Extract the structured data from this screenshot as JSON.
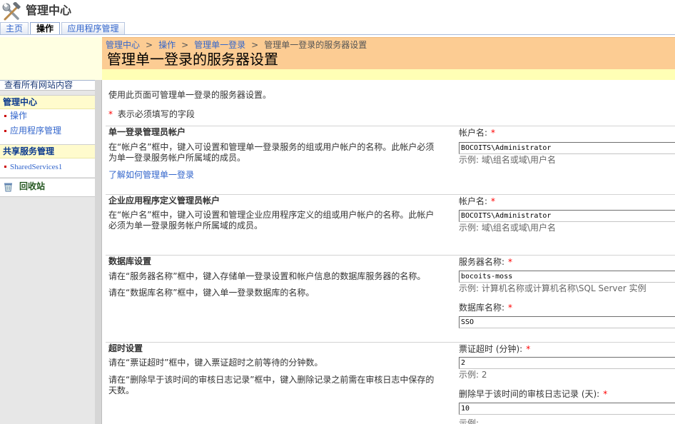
{
  "theme": {
    "link": "#3366cc",
    "title_band": "#fccc93",
    "required": "#ff0000"
  },
  "header": {
    "title": "管理中心",
    "icon": "tools-icon"
  },
  "tabs": [
    {
      "label": "主页",
      "selected": false
    },
    {
      "label": "操作",
      "selected": true
    },
    {
      "label": "应用程序管理",
      "selected": false
    }
  ],
  "breadcrumb": {
    "items": [
      "管理中心",
      "操作",
      "管理单一登录",
      "管理单一登录的服务器设置"
    ],
    "separator": ">"
  },
  "page_title": "管理单一登录的服务器设置",
  "leftnav": {
    "view_all": "查看所有网站内容",
    "groups": [
      {
        "header": "管理中心",
        "items": [
          "操作",
          "应用程序管理"
        ]
      },
      {
        "header": "共享服务管理",
        "items": [
          "SharedServices1"
        ]
      }
    ],
    "recycle_bin": {
      "label": "回收站",
      "icon": "recycle-bin-icon"
    }
  },
  "form": {
    "intro": "使用此页面可管理单一登录的服务器设置。",
    "required_marker": "*",
    "required_note": "表示必须填写的字段",
    "sections": [
      {
        "title": "单一登录管理员帐户",
        "descriptions": [
          "在“帐户名”框中，键入可设置和管理单一登录服务的组或用户帐户的名称。此帐户必须为单一登录服务帐户所属域的成员。"
        ],
        "link": "了解如何管理单一登录",
        "fields": [
          {
            "label": "帐户名:",
            "value": "BOCOITS\\Administrator",
            "example": "示例: 域\\组名或域\\用户名"
          }
        ]
      },
      {
        "title": "企业应用程序定义管理员帐户",
        "descriptions": [
          "在“帐户名”框中，键入可设置和管理企业应用程序定义的组或用户帐户的名称。此帐户必须为单一登录服务帐户所属域的成员。"
        ],
        "fields": [
          {
            "label": "帐户名:",
            "value": "BOCOITS\\Administrator",
            "example": "示例: 域\\组名或域\\用户名"
          }
        ]
      },
      {
        "title": "数据库设置",
        "descriptions": [
          "请在“服务器名称”框中，键入存储单一登录设置和帐户信息的数据库服务器的名称。",
          "请在“数据库名称”框中，键入单一登录数据库的名称。"
        ],
        "fields": [
          {
            "label": "服务器名称:",
            "value": "bocoits-moss",
            "example": "示例: 计算机名称或计算机名称\\SQL Server 实例"
          },
          {
            "label": "数据库名称:",
            "value": "SSO"
          }
        ]
      },
      {
        "title": "超时设置",
        "descriptions": [
          "请在“票证超时”框中，键入票证超时之前等待的分钟数。",
          "请在“删除早于该时间的审核日志记录”框中，键入删除记录之前需在审核日志中保存的天数。"
        ],
        "fields": [
          {
            "label": "票证超时 (分钟):",
            "value": "2",
            "example": "示例: 2"
          },
          {
            "label": "删除早于该时间的审核日志记录 (天):",
            "value": "10",
            "example": "示例:"
          }
        ]
      }
    ]
  }
}
